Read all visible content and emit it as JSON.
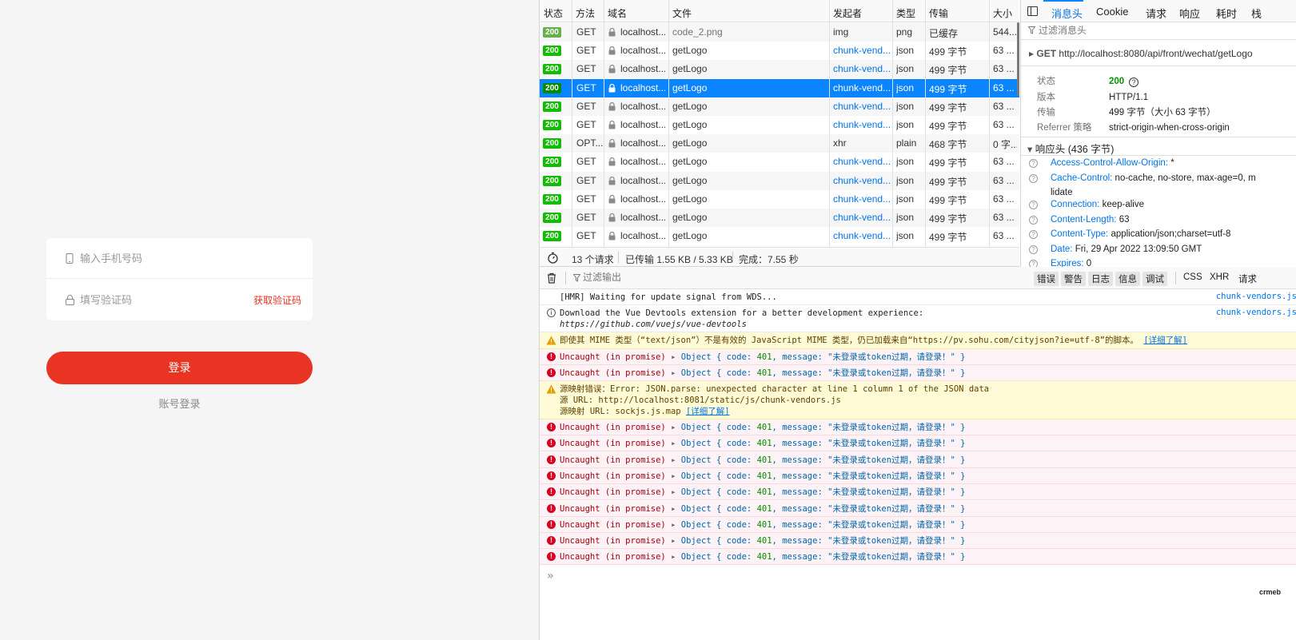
{
  "login": {
    "phone_placeholder": "输入手机号码",
    "code_placeholder": "填写验证码",
    "get_code": "获取验证码",
    "login_button": "登录",
    "account_login": "账号登录"
  },
  "network": {
    "headers": [
      "状态",
      "方法",
      "域名",
      "文件",
      "发起者",
      "类型",
      "传输",
      "大小"
    ],
    "rows": [
      {
        "status": "200",
        "method": "GET",
        "domain": "localhost...",
        "file": "code_2.png",
        "initiator": "img",
        "type": "png",
        "transfer": "已缓存",
        "size": "544..."
      },
      {
        "status": "200",
        "method": "GET",
        "domain": "localhost...",
        "file": "getLogo",
        "initiator": "chunk-vend...",
        "type": "json",
        "transfer": "499 字节",
        "size": "63 ..."
      },
      {
        "status": "200",
        "method": "GET",
        "domain": "localhost...",
        "file": "getLogo",
        "initiator": "chunk-vend...",
        "type": "json",
        "transfer": "499 字节",
        "size": "63 ..."
      },
      {
        "status": "200",
        "method": "GET",
        "domain": "localhost...",
        "file": "getLogo",
        "initiator": "chunk-vend...",
        "type": "json",
        "transfer": "499 字节",
        "size": "63 ..."
      },
      {
        "status": "200",
        "method": "GET",
        "domain": "localhost...",
        "file": "getLogo",
        "initiator": "chunk-vend...",
        "type": "json",
        "transfer": "499 字节",
        "size": "63 ..."
      },
      {
        "status": "200",
        "method": "GET",
        "domain": "localhost...",
        "file": "getLogo",
        "initiator": "chunk-vend...",
        "type": "json",
        "transfer": "499 字节",
        "size": "63 ..."
      },
      {
        "status": "200",
        "method": "OPT...",
        "domain": "localhost...",
        "file": "getLogo",
        "initiator": "xhr",
        "type": "plain",
        "transfer": "468 字节",
        "size": "0 字..."
      },
      {
        "status": "200",
        "method": "GET",
        "domain": "localhost...",
        "file": "getLogo",
        "initiator": "chunk-vend...",
        "type": "json",
        "transfer": "499 字节",
        "size": "63 ..."
      },
      {
        "status": "200",
        "method": "GET",
        "domain": "localhost...",
        "file": "getLogo",
        "initiator": "chunk-vend...",
        "type": "json",
        "transfer": "499 字节",
        "size": "63 ..."
      },
      {
        "status": "200",
        "method": "GET",
        "domain": "localhost...",
        "file": "getLogo",
        "initiator": "chunk-vend...",
        "type": "json",
        "transfer": "499 字节",
        "size": "63 ..."
      },
      {
        "status": "200",
        "method": "GET",
        "domain": "localhost...",
        "file": "getLogo",
        "initiator": "chunk-vend...",
        "type": "json",
        "transfer": "499 字节",
        "size": "63 ..."
      },
      {
        "status": "200",
        "method": "GET",
        "domain": "localhost...",
        "file": "getLogo",
        "initiator": "chunk-vend...",
        "type": "json",
        "transfer": "499 字节",
        "size": "63 ..."
      }
    ],
    "summary": {
      "requests": "13 个请求",
      "transferred": "已传输 1.55 KB / 5.33 KB",
      "finished": "完成：7.55 秒"
    }
  },
  "details": {
    "tabs": [
      "消息头",
      "Cookie",
      "请求",
      "响应",
      "耗时",
      "栈"
    ],
    "filter_placeholder": "过滤消息头",
    "request_method": "GET",
    "request_url": "http://localhost:8080/api/front/wechat/getLogo",
    "summary": [
      {
        "key": "状态",
        "value": "200"
      },
      {
        "key": "版本",
        "value": "HTTP/1.1"
      },
      {
        "key": "传输",
        "value": "499 字节（大小 63 字节）"
      },
      {
        "key": "Referrer 策略",
        "value": "strict-origin-when-cross-origin"
      }
    ],
    "response_headers_title": "响应头 (436 字节)",
    "response_headers": [
      {
        "key": "Access-Control-Allow-Origin:",
        "value": "*"
      },
      {
        "key": "Cache-Control:",
        "value": "no-cache, no-store, max-age=0, m"
      },
      {
        "key": "",
        "value": "lidate"
      },
      {
        "key": "Connection:",
        "value": "keep-alive"
      },
      {
        "key": "Content-Length:",
        "value": "63"
      },
      {
        "key": "Content-Type:",
        "value": "application/json;charset=utf-8"
      },
      {
        "key": "Date:",
        "value": "Fri, 29 Apr 2022 13:09:50 GMT"
      },
      {
        "key": "Expires:",
        "value": "0"
      }
    ]
  },
  "console": {
    "filter_placeholder": "过滤输出",
    "levels": [
      "错误",
      "警告",
      "日志",
      "信息",
      "调试"
    ],
    "types": [
      "CSS",
      "XHR",
      "请求"
    ],
    "source_chunk": "chunk-vendors.js",
    "hmr": "[HMR] Waiting for update signal from WDS...",
    "devtools_line1": "Download the Vue Devtools extension for a better development experience:",
    "devtools_line2": "https://github.com/vuejs/vue-devtools",
    "mime_warning": "即使其 MIME 类型（“text/json”）不是有效的 JavaScript MIME 类型，仍已加载来自“https://pv.sohu.com/cityjson?ie=utf-8”的脚本。",
    "learn_more": "[详细了解]",
    "uncaught": "Uncaught (in promise)",
    "object_prefix": "Object { code: ",
    "code": "401",
    "message_key": ", message: ",
    "message_value": "\"未登录或token过期，请登录！\" }",
    "sourcemap_line1": "源映射错误：Error: JSON.parse: unexpected character at line 1 column 1 of the JSON data",
    "sourcemap_line2": "源 URL: http://localhost:8081/static/js/chunk-vendors.js",
    "sourcemap_line3": "源映射 URL: sockjs.js.map",
    "brand": "crmeb"
  }
}
